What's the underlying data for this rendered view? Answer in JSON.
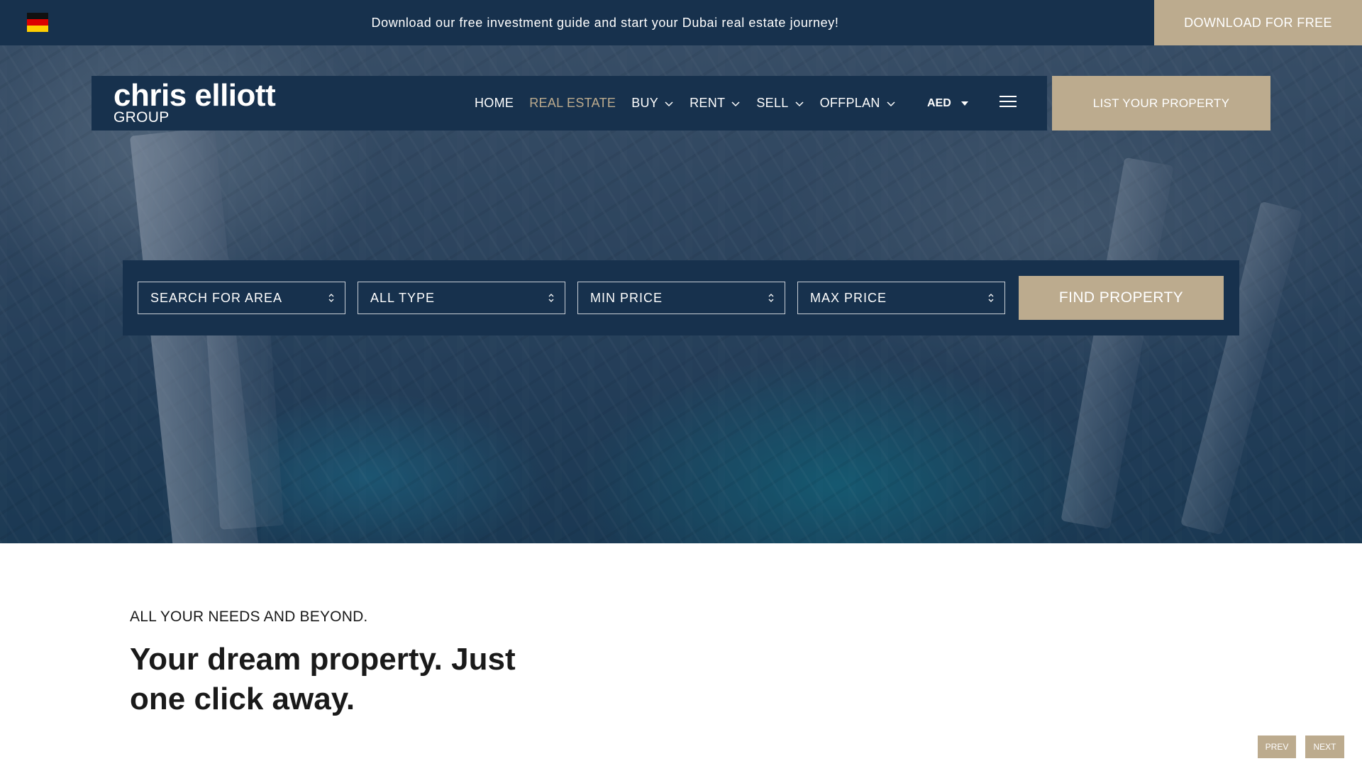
{
  "promo": {
    "text": "Download our free investment guide and start your Dubai real estate journey!",
    "button": "DOWNLOAD FOR FREE",
    "flag_icon": "germany-flag-icon"
  },
  "logo": {
    "main": "chris elliott",
    "sub": "GROUP"
  },
  "nav": {
    "items": [
      {
        "label": "HOME",
        "dropdown": false
      },
      {
        "label": "REAL ESTATE",
        "dropdown": false,
        "active": true
      },
      {
        "label": "BUY",
        "dropdown": true
      },
      {
        "label": "RENT",
        "dropdown": true
      },
      {
        "label": "SELL",
        "dropdown": true
      },
      {
        "label": "OFFPLAN",
        "dropdown": true
      }
    ],
    "currency": "AED",
    "menu_icon": "hamburger-menu-icon",
    "list_button": "LIST YOUR PROPERTY"
  },
  "search": {
    "area": "SEARCH FOR AREA",
    "type": "ALL TYPE",
    "min_price": "MIN PRICE",
    "max_price": "MAX PRICE",
    "button": "FIND PROPERTY"
  },
  "intro": {
    "eyebrow": "ALL YOUR NEEDS AND BEYOND.",
    "headline": "Your dream property. Just one click away."
  },
  "slider": {
    "prev": "PREV",
    "next": "NEXT"
  },
  "colors": {
    "navy": "#17314d",
    "gold": "#bcab8e",
    "active_link": "#bcab8e"
  }
}
